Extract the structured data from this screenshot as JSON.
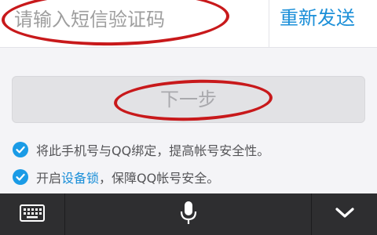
{
  "sms_input": {
    "placeholder": "请输入短信验证码",
    "value": ""
  },
  "resend_button": {
    "label": "重新发送"
  },
  "next_button": {
    "label": "下一步",
    "enabled": false
  },
  "options": [
    {
      "checked": true,
      "text": "将此手机号与QQ绑定，提高帐号安全性。"
    },
    {
      "checked": true,
      "text_before": "开启",
      "link_text": "设备锁",
      "text_after": "，保障QQ帐号安全。"
    }
  ],
  "keyboard_bar": {
    "icons": [
      "keyboard-icon",
      "microphone-icon",
      "chevron-down-icon"
    ]
  },
  "colors": {
    "accent": "#1b8fd8",
    "annotation": "#c8191b",
    "check": "#1a9be6",
    "ime_bar": "#2e2e30"
  }
}
